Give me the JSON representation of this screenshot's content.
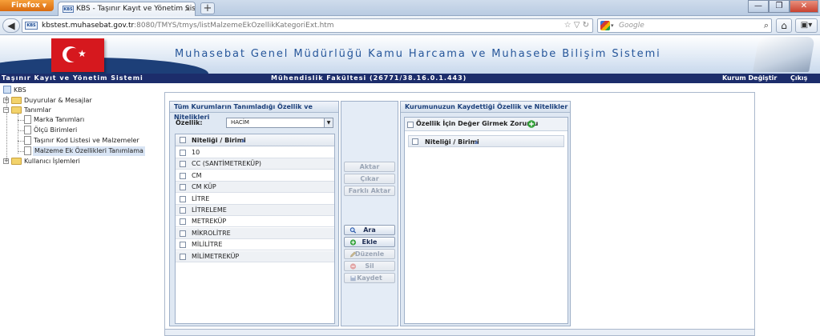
{
  "browser": {
    "menu_button": "Firefox",
    "tab_title": "KBS - Taşınır Kayıt ve Yönetim Sistemi",
    "favicon_text": "KBS",
    "url_host": "kbstest.muhasebat.gov.tr",
    "url_rest": ":8080/TMYS/tmys/listMalzemeEkOzellikKategoriExt.htm",
    "search_placeholder": "Google"
  },
  "banner": {
    "title": "Muhasebat Genel Müdürlüğü Kamu Harcama ve Muhasebe Bilişim Sistemi"
  },
  "infobar": {
    "system": "Taşınır Kayıt ve Yönetim Sistemi",
    "unit": "Mühendislik Fakültesi (26771/38.16.0.1.443)",
    "change_org": "Kurum Değiştir",
    "logout": "Çıkış"
  },
  "tree": {
    "root": "KBS",
    "items": {
      "duyurular": "Duyurular & Mesajlar",
      "tanimlar": "Tanımlar",
      "marka": "Marka Tanımları",
      "olcu": "Ölçü Birimleri",
      "kod": "Taşınır Kod Listesi ve Malzemeler",
      "ek": "Malzeme Ek Özellikleri Tanımlama",
      "kullanici": "Kullanıcı İşlemleri"
    }
  },
  "left_panel": {
    "title": "Tüm Kurumların Tanımladığı Özellik ve Nitelikleri",
    "ozellik_label": "Özellik:",
    "ozellik_value": "HACİM",
    "column": "Niteliği / Birimi",
    "rows": [
      "10",
      "CC (SANTİMETREKÜP)",
      "CM",
      "CM KÜP",
      "LİTRE",
      "LİTRELEME",
      "METREKÜP",
      "MİKROLİTRE",
      "MİLİLİTRE",
      "MİLİMETREKÜP"
    ]
  },
  "middle_buttons": {
    "aktar": "Aktar",
    "cikar": "Çıkar",
    "farkli_aktar": "Farklı Aktar",
    "ara": "Ara",
    "ekle": "Ekle",
    "duzenle": "Düzenle",
    "sil": "Sil",
    "kaydet": "Kaydet"
  },
  "right_panel": {
    "title": "Kurumunuzun Kaydettiği Özellik ve Nitelikler",
    "mandatory_label": "Özellik İçin Değer Girmek Zorunlu",
    "column": "Niteliği / Birimi"
  },
  "colors": {
    "infobar": "#1c2d6b",
    "banner_title": "#26569a",
    "panel_header_text": "#1b3f7a"
  }
}
